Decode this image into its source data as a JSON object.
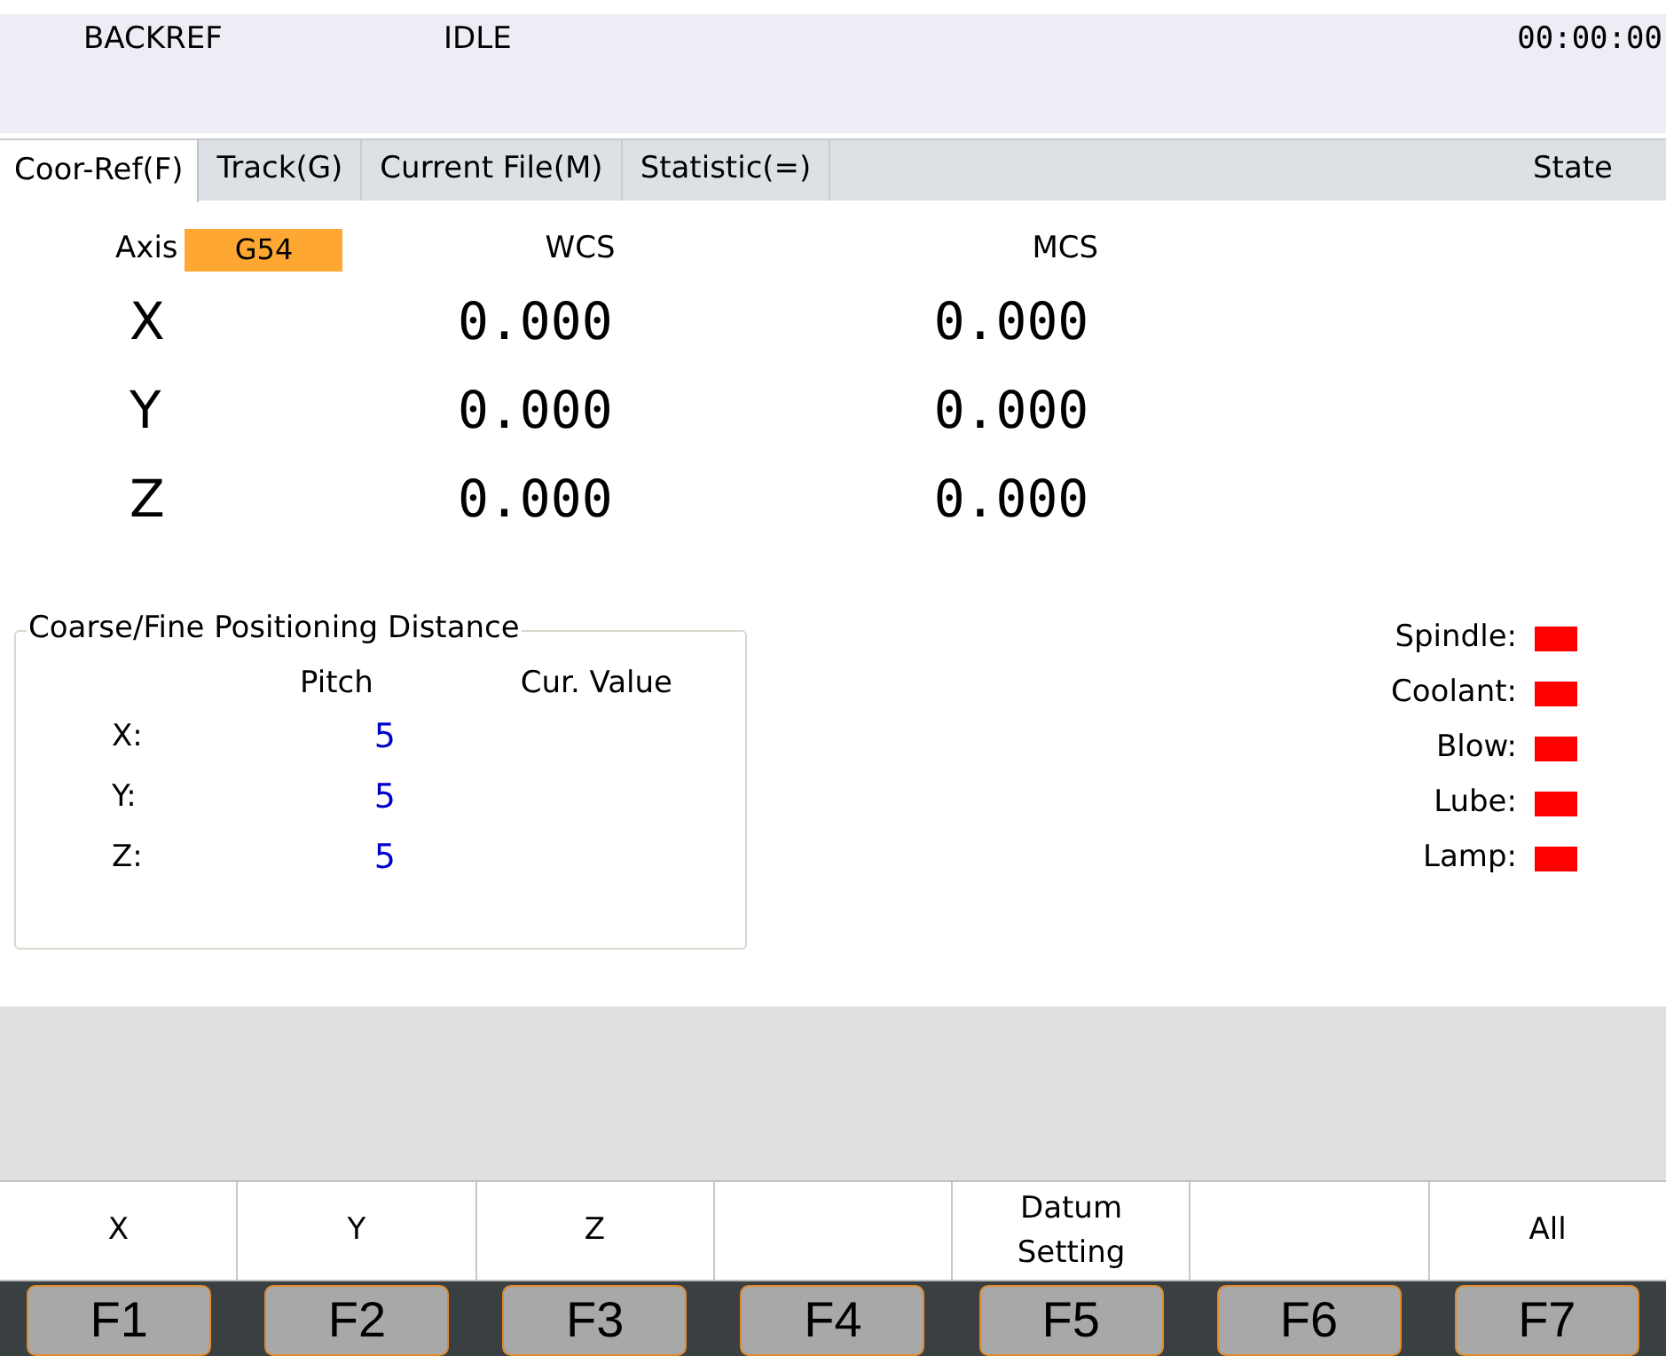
{
  "status_bar": {
    "mode": "BACKREF",
    "state": "IDLE",
    "time": "00:00:00"
  },
  "tabs": [
    {
      "label": "Coor-Ref(F)",
      "selected": true
    },
    {
      "label": "Track(G)",
      "selected": false
    },
    {
      "label": "Current File(M)",
      "selected": false
    },
    {
      "label": "Statistic(=)",
      "selected": false
    }
  ],
  "state_label": "State",
  "coordinates": {
    "axis_label": "Axis",
    "wcs_select": "G54",
    "wcs_header": "WCS",
    "mcs_header": "MCS",
    "rows": [
      {
        "axis": "X",
        "wcs": "0.000",
        "mcs": "0.000"
      },
      {
        "axis": "Y",
        "wcs": "0.000",
        "mcs": "0.000"
      },
      {
        "axis": "Z",
        "wcs": "0.000",
        "mcs": "0.000"
      }
    ]
  },
  "positioning": {
    "title": "Coarse/Fine Positioning Distance",
    "pitch_header": "Pitch",
    "value_header": "Cur. Value",
    "rows": [
      {
        "axis": "X:",
        "pitch": "5"
      },
      {
        "axis": "Y:",
        "pitch": "5"
      },
      {
        "axis": "Z:",
        "pitch": "5"
      }
    ]
  },
  "indicators": [
    {
      "label": "Spindle:",
      "color": "#ff0000"
    },
    {
      "label": "Coolant:",
      "color": "#ff0000"
    },
    {
      "label": "Blow:",
      "color": "#ff0000"
    },
    {
      "label": "Lube:",
      "color": "#ff0000"
    },
    {
      "label": "Lamp:",
      "color": "#ff0000"
    }
  ],
  "softkeys": [
    {
      "label": "X",
      "key": "F1"
    },
    {
      "label": "Y",
      "key": "F2"
    },
    {
      "label": "Z",
      "key": "F3"
    },
    {
      "key": "F4"
    },
    {
      "label": "Datum Setting",
      "key": "F5"
    },
    {
      "key": "F6"
    },
    {
      "label": "All",
      "key": "F7"
    }
  ]
}
